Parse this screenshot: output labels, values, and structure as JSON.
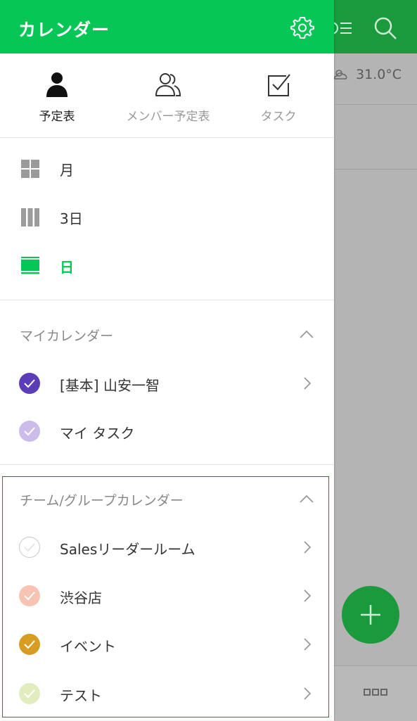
{
  "app": {
    "title": "カレンダー",
    "settings_icon": "gear-icon",
    "accent_color": "#06c755"
  },
  "background": {
    "weather": "31.0°C"
  },
  "view_tabs": [
    {
      "label": "予定表",
      "icon": "person-icon",
      "selected": true
    },
    {
      "label": "メンバー予定表",
      "icon": "people-icon",
      "selected": false
    },
    {
      "label": "タスク",
      "icon": "checkbox-icon",
      "selected": false
    }
  ],
  "display_modes": [
    {
      "label": "月",
      "icon": "grid-icon",
      "selected": false
    },
    {
      "label": "3日",
      "icon": "columns-icon",
      "selected": false
    },
    {
      "label": "日",
      "icon": "day-view-icon",
      "selected": true
    }
  ],
  "my_calendars": {
    "title": "マイカレンダー",
    "items": [
      {
        "label": "[基本] 山安一智",
        "color": "#5b3db8",
        "has_chevron": true
      },
      {
        "label": "マイ タスク",
        "color": "#cbbcea",
        "has_chevron": false
      }
    ]
  },
  "team_calendars": {
    "title": "チーム/グループカレンダー",
    "items": [
      {
        "label": "Salesリーダールーム",
        "color": "#ffffff"
      },
      {
        "label": "渋谷店",
        "color": "#f7c4b3"
      },
      {
        "label": "イベント",
        "color": "#d69d22"
      },
      {
        "label": "テスト",
        "color": "#e2edbf"
      }
    ]
  }
}
